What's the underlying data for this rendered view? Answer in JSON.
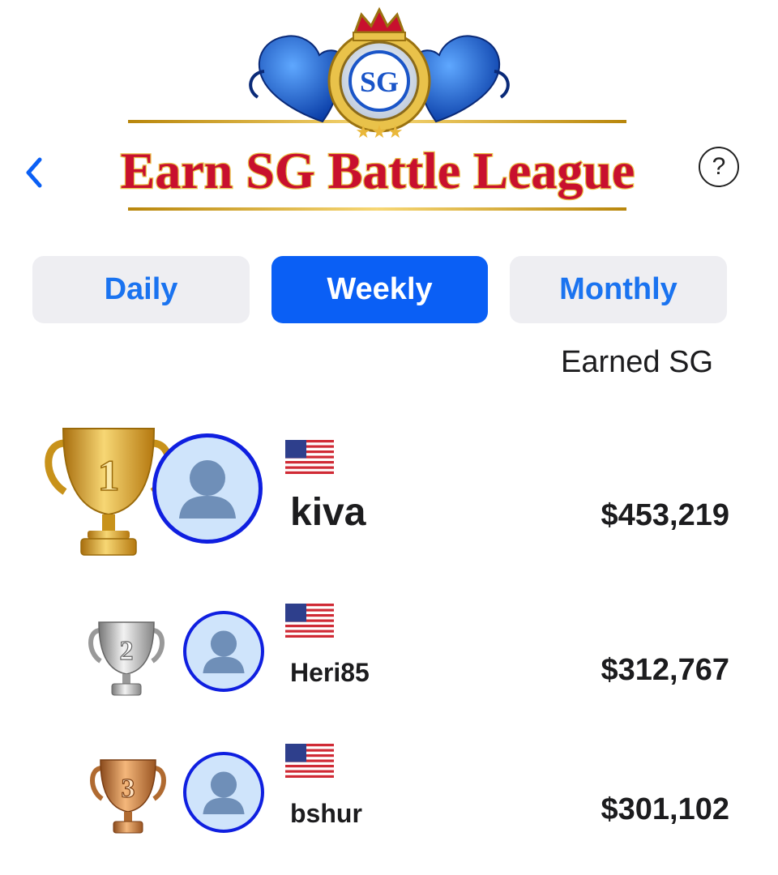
{
  "header": {
    "logo_text": "Earn SG Battle League",
    "logo_emblem_text": "SG",
    "back_icon": "chevron-left-icon",
    "help_label": "?"
  },
  "tabs": [
    {
      "label": "Daily",
      "active": false
    },
    {
      "label": "Weekly",
      "active": true
    },
    {
      "label": "Monthly",
      "active": false
    }
  ],
  "column_header": "Earned SG",
  "leaderboard": [
    {
      "rank": "1",
      "trophy": "gold-trophy-icon",
      "flag": "us-flag-icon",
      "username": "kiva",
      "earned": "$453,219"
    },
    {
      "rank": "2",
      "trophy": "silver-trophy-icon",
      "flag": "us-flag-icon",
      "username": "Heri85",
      "earned": "$312,767"
    },
    {
      "rank": "3",
      "trophy": "bronze-trophy-icon",
      "flag": "us-flag-icon",
      "username": "bshur",
      "earned": "$301,102"
    }
  ],
  "colors": {
    "accent": "#0a5ff5",
    "tab_inactive_bg": "#eeeef2",
    "tab_inactive_text": "#1a73f0",
    "avatar_border": "#0f1fe0",
    "avatar_bg": "#cfe4fb",
    "logo_text": "#c8102e",
    "gold": "#d9a520"
  }
}
